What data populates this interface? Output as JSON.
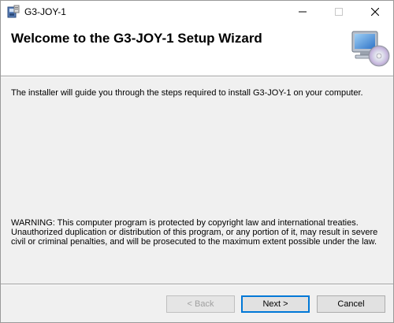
{
  "window": {
    "title": "G3-JOY-1"
  },
  "header": {
    "title": "Welcome to the G3-JOY-1 Setup Wizard"
  },
  "body": {
    "intro": "The installer will guide you through the steps required to install G3-JOY-1 on your computer.",
    "warning": "WARNING: This computer program is protected by copyright law and international treaties. Unauthorized duplication or distribution of this program, or any portion of it, may result in severe civil or criminal penalties, and will be prosecuted to the maximum extent possible under the law."
  },
  "buttons": {
    "back": "< Back",
    "next": "Next >",
    "cancel": "Cancel"
  },
  "icons": {
    "app": "installer-icon",
    "banner": "computer-cd-icon",
    "minimize": "minimize-icon",
    "maximize": "maximize-icon",
    "close": "close-icon"
  },
  "colors": {
    "accent": "#0078d7",
    "window_bg": "#f0f0f0",
    "header_bg": "#ffffff"
  }
}
